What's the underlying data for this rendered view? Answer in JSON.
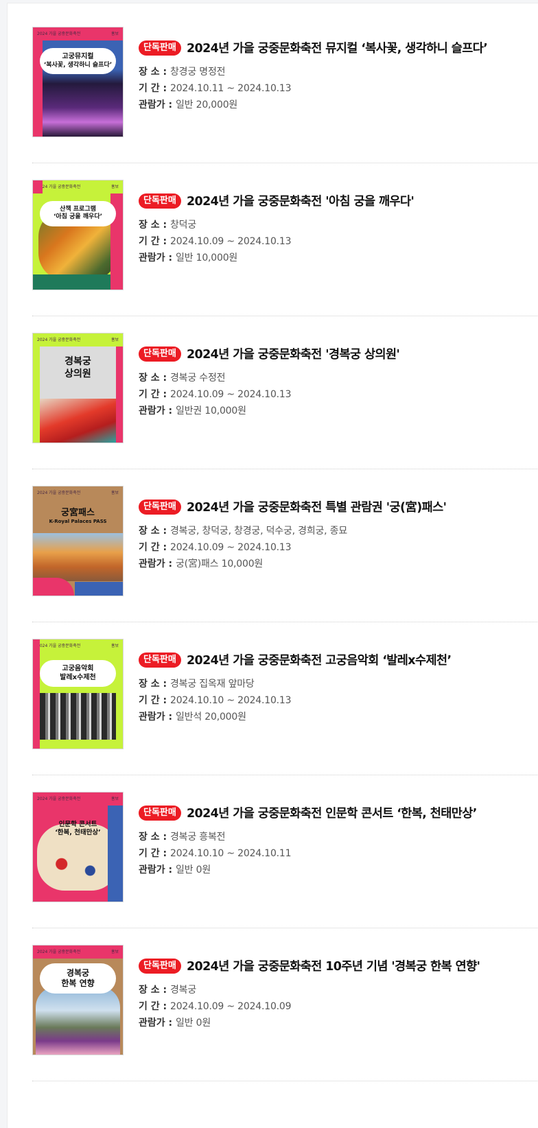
{
  "badge_label": "단독판매",
  "labels": {
    "place": "장  소 : ",
    "period": "기  간 : ",
    "price": "관람가 : "
  },
  "events": [
    {
      "title": "2024년 가을 궁중문화축전 뮤지컬 ‘복사꽃, 생각하니 슬프다’",
      "place": "창경궁 명정전",
      "period": "2024.10.11 ~ 2024.10.13",
      "price": "일반 20,000원",
      "poster": {
        "header": "2024 가을 궁중문화축전",
        "mark": "홍보",
        "line1": "고궁뮤지컬",
        "line2": "‘복사꽃, 생각하니 슬프다’",
        "colors": [
          "#e9356a",
          "#3b63b4",
          "#241a3d"
        ]
      }
    },
    {
      "title": "2024년 가을 궁중문화축전 '아침 궁을 깨우다'",
      "place": "창덕궁",
      "period": "2024.10.09 ~ 2024.10.13",
      "price": "일반 10,000원",
      "poster": {
        "header": "2024 가을 궁중문화축전",
        "mark": "홍보",
        "line1": "산책 프로그램",
        "line2": "‘아침 궁을 깨우다’",
        "colors": [
          "#e9356a",
          "#c6f23a",
          "#d9771e"
        ]
      }
    },
    {
      "title": "2024년 가을 궁중문화축전 '경복궁 상의원'",
      "place": "경복궁 수정전",
      "period": "2024.10.09 ~ 2024.10.13",
      "price": "일반권 10,000원",
      "poster": {
        "header": "2024 가을 궁중문화축전",
        "mark": "홍보",
        "line1": "경복궁",
        "line2": "상의원",
        "colors": [
          "#c6f23a",
          "#e9356a",
          "#d9d9d9"
        ]
      }
    },
    {
      "title": "2024년 가을 궁중문화축전 특별 관람권 '궁(宮)패스'",
      "place": "경복궁, 창덕궁, 창경궁, 덕수궁, 경희궁, 종묘",
      "period": "2024.10.09 ~ 2024.10.13",
      "price": "궁(宮)패스 10,000원",
      "poster": {
        "header": "2024 가을 궁중문화축전",
        "mark": "홍보",
        "line1": "궁宮패스",
        "line2": "K-Royal Palaces PASS",
        "colors": [
          "#b8895a",
          "#e9356a",
          "#3b63b4"
        ]
      }
    },
    {
      "title": "2024년 가을 궁중문화축전 고궁음악회 ‘발레x수제천’",
      "place": "경복궁 집옥재 앞마당",
      "period": "2024.10.10 ~ 2024.10.13",
      "price": "일반석 20,000원",
      "poster": {
        "header": "2024 가을 궁중문화축전",
        "mark": "홍보",
        "line1": "고궁음악회",
        "line2": "발레x수제천",
        "colors": [
          "#c6f23a",
          "#e9356a",
          "#3a3a3a"
        ]
      }
    },
    {
      "title": "2024년 가을 궁중문화축전 인문학 콘서트 ‘한복, 천태만상’",
      "place": "경복궁 흥복전",
      "period": "2024.10.10 ~ 2024.10.11",
      "price": "일반 0원",
      "poster": {
        "header": "2024 가을 궁중문화축전",
        "mark": "홍보",
        "line1": "인문학 콘서트",
        "line2": "‘한복, 천태만상’",
        "colors": [
          "#e9356a",
          "#3b63b4",
          "#efe0c4"
        ]
      }
    },
    {
      "title": "2024년 가을 궁중문화축전 10주년 기념 '경복궁 한복 연향'",
      "place": "경복궁",
      "period": "2024.10.09 ~ 2024.10.09",
      "price": "일반 0원",
      "poster": {
        "header": "2024 가을 궁중문화축전",
        "mark": "홍보",
        "line1": "경복궁",
        "line2": "한복 연향",
        "colors": [
          "#e9356a",
          "#b8895a",
          "#8fb6d8"
        ]
      }
    }
  ]
}
